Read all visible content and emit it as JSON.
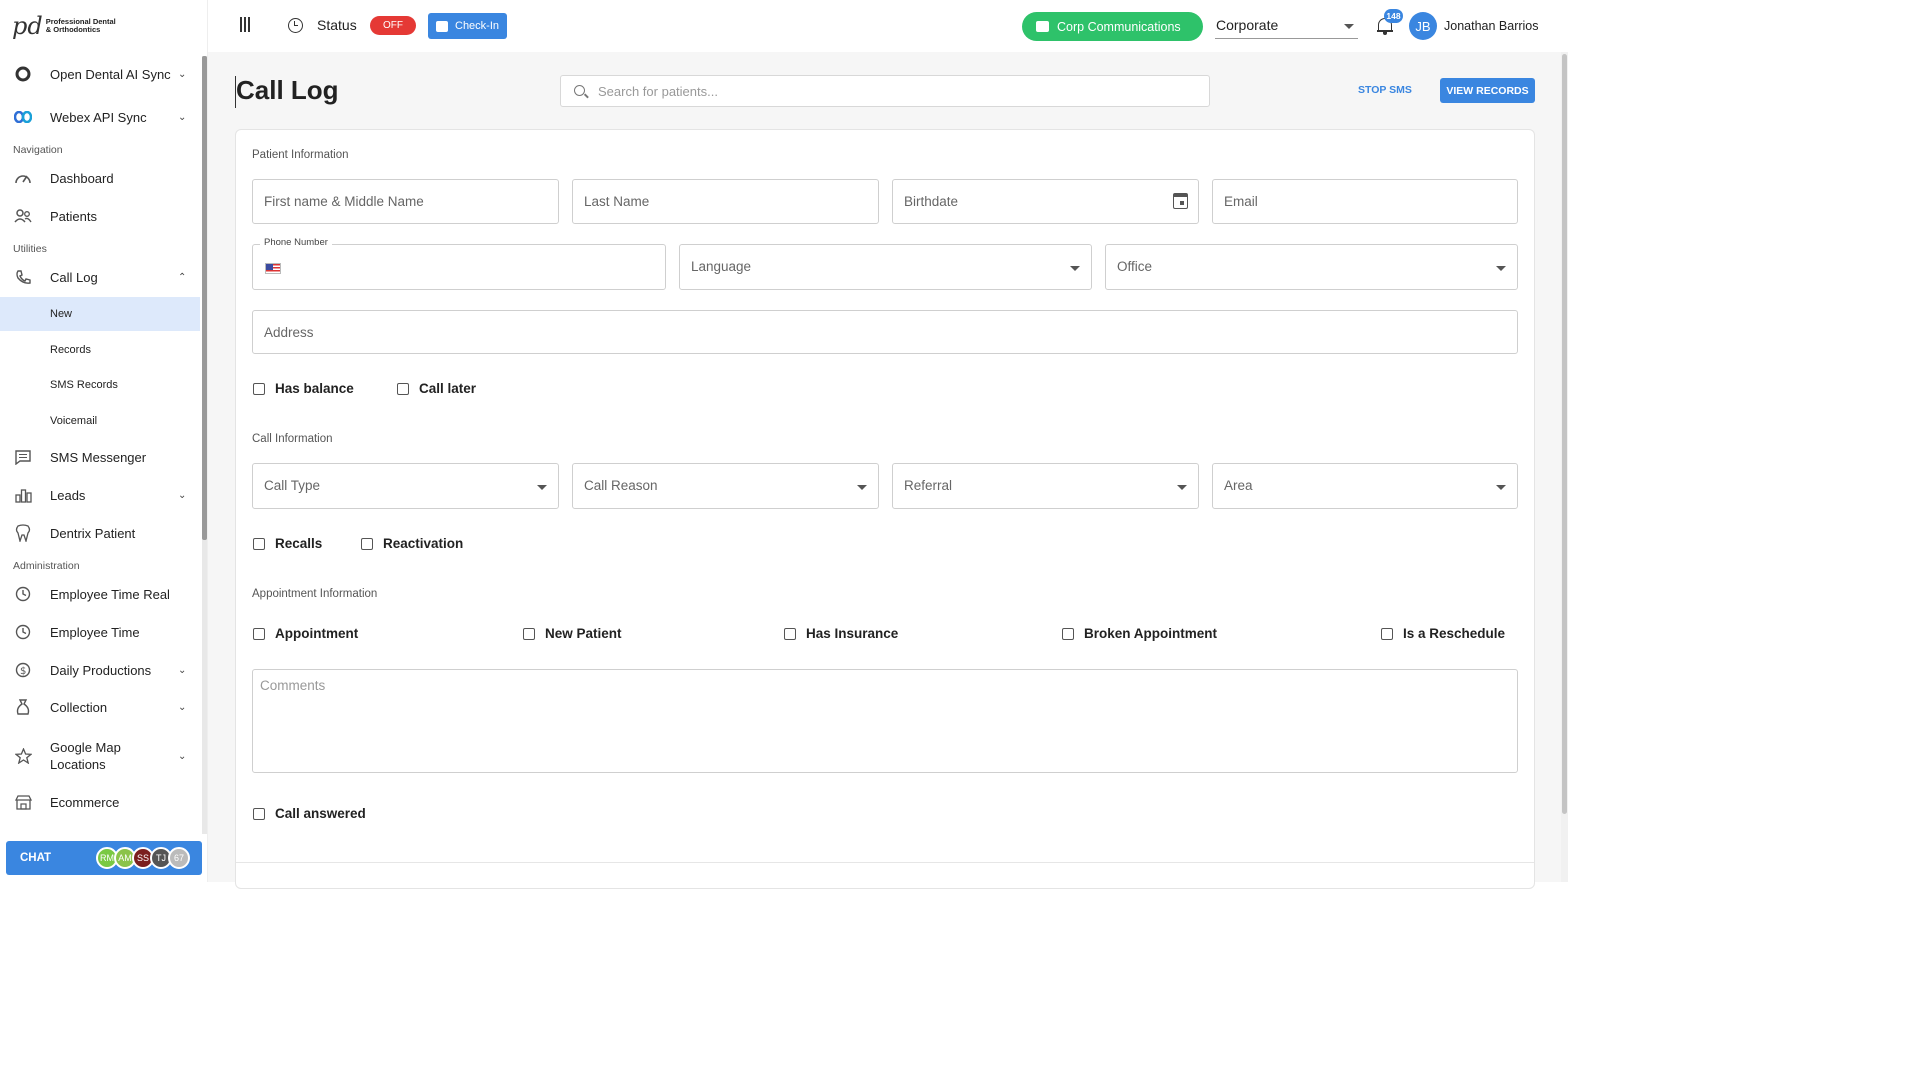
{
  "brand": {
    "logo_mark": "pd",
    "logo_line1": "Professional Dental",
    "logo_line2": "& Orthodontics"
  },
  "sidebar": {
    "items_top": [
      {
        "label": "Open Dental AI Sync",
        "icon": "circle-ring-icon"
      },
      {
        "label": "Webex API Sync",
        "icon": "webex-icon"
      }
    ],
    "sections": {
      "navigation": "Navigation",
      "utilities": "Utilities",
      "administration": "Administration"
    },
    "navigation": [
      {
        "label": "Dashboard",
        "icon": "gauge-icon"
      },
      {
        "label": "Patients",
        "icon": "users-icon"
      }
    ],
    "utilities": [
      {
        "label": "Call Log",
        "icon": "phone-icon"
      },
      {
        "label": "SMS Messenger",
        "icon": "message-icon"
      },
      {
        "label": "Leads",
        "icon": "chart-icon"
      },
      {
        "label": "Dentrix Patient",
        "icon": "tooth-icon"
      }
    ],
    "call_log_sub": [
      "New",
      "Records",
      "SMS Records",
      "Voicemail"
    ],
    "administration": [
      {
        "label": "Employee Time Real",
        "icon": "clock-icon"
      },
      {
        "label": "Employee Time",
        "icon": "clock-icon"
      },
      {
        "label": "Daily Productions",
        "icon": "dollar-icon"
      },
      {
        "label": "Collection",
        "icon": "bag-icon"
      },
      {
        "label": "Google Map Locations",
        "icon": "star-icon"
      },
      {
        "label": "Ecommerce",
        "icon": "store-icon"
      }
    ],
    "chat": {
      "label": "CHAT",
      "avatars": [
        "RM",
        "AM",
        "SS",
        "TJ",
        "67"
      ]
    }
  },
  "topbar": {
    "status_label": "Status",
    "status_value": "OFF",
    "checkin_label": "Check-In",
    "corp_comm_label": "Corp Communications",
    "office_select": "Corporate",
    "notification_count": "148",
    "user_initials": "JB",
    "user_name": "Jonathan Barrios"
  },
  "page": {
    "title": "Call Log",
    "search_placeholder": "Search for patients...",
    "stop_sms": "STOP SMS",
    "view_records": "VIEW RECORDS"
  },
  "patient_info": {
    "title": "Patient Information",
    "first_name": "First name & Middle Name",
    "last_name": "Last Name",
    "birthdate": "Birthdate",
    "email": "Email",
    "phone_label": "Phone Number",
    "language": "Language",
    "office": "Office",
    "address": "Address",
    "has_balance": "Has balance",
    "call_later": "Call later"
  },
  "call_info": {
    "title": "Call Information",
    "call_type": "Call Type",
    "call_reason": "Call Reason",
    "referral": "Referral",
    "area": "Area",
    "recalls": "Recalls",
    "reactivation": "Reactivation"
  },
  "appointment_info": {
    "title": "Appointment Information",
    "appointment": "Appointment",
    "new_patient": "New Patient",
    "has_insurance": "Has Insurance",
    "broken_appointment": "Broken Appointment",
    "is_reschedule": "Is a Reschedule",
    "comments_placeholder": "Comments",
    "call_answered": "Call answered"
  },
  "colors": {
    "primary": "#3a86e0",
    "green": "#2ec26a",
    "red": "#e53935",
    "active_bg": "#dde9fb"
  }
}
